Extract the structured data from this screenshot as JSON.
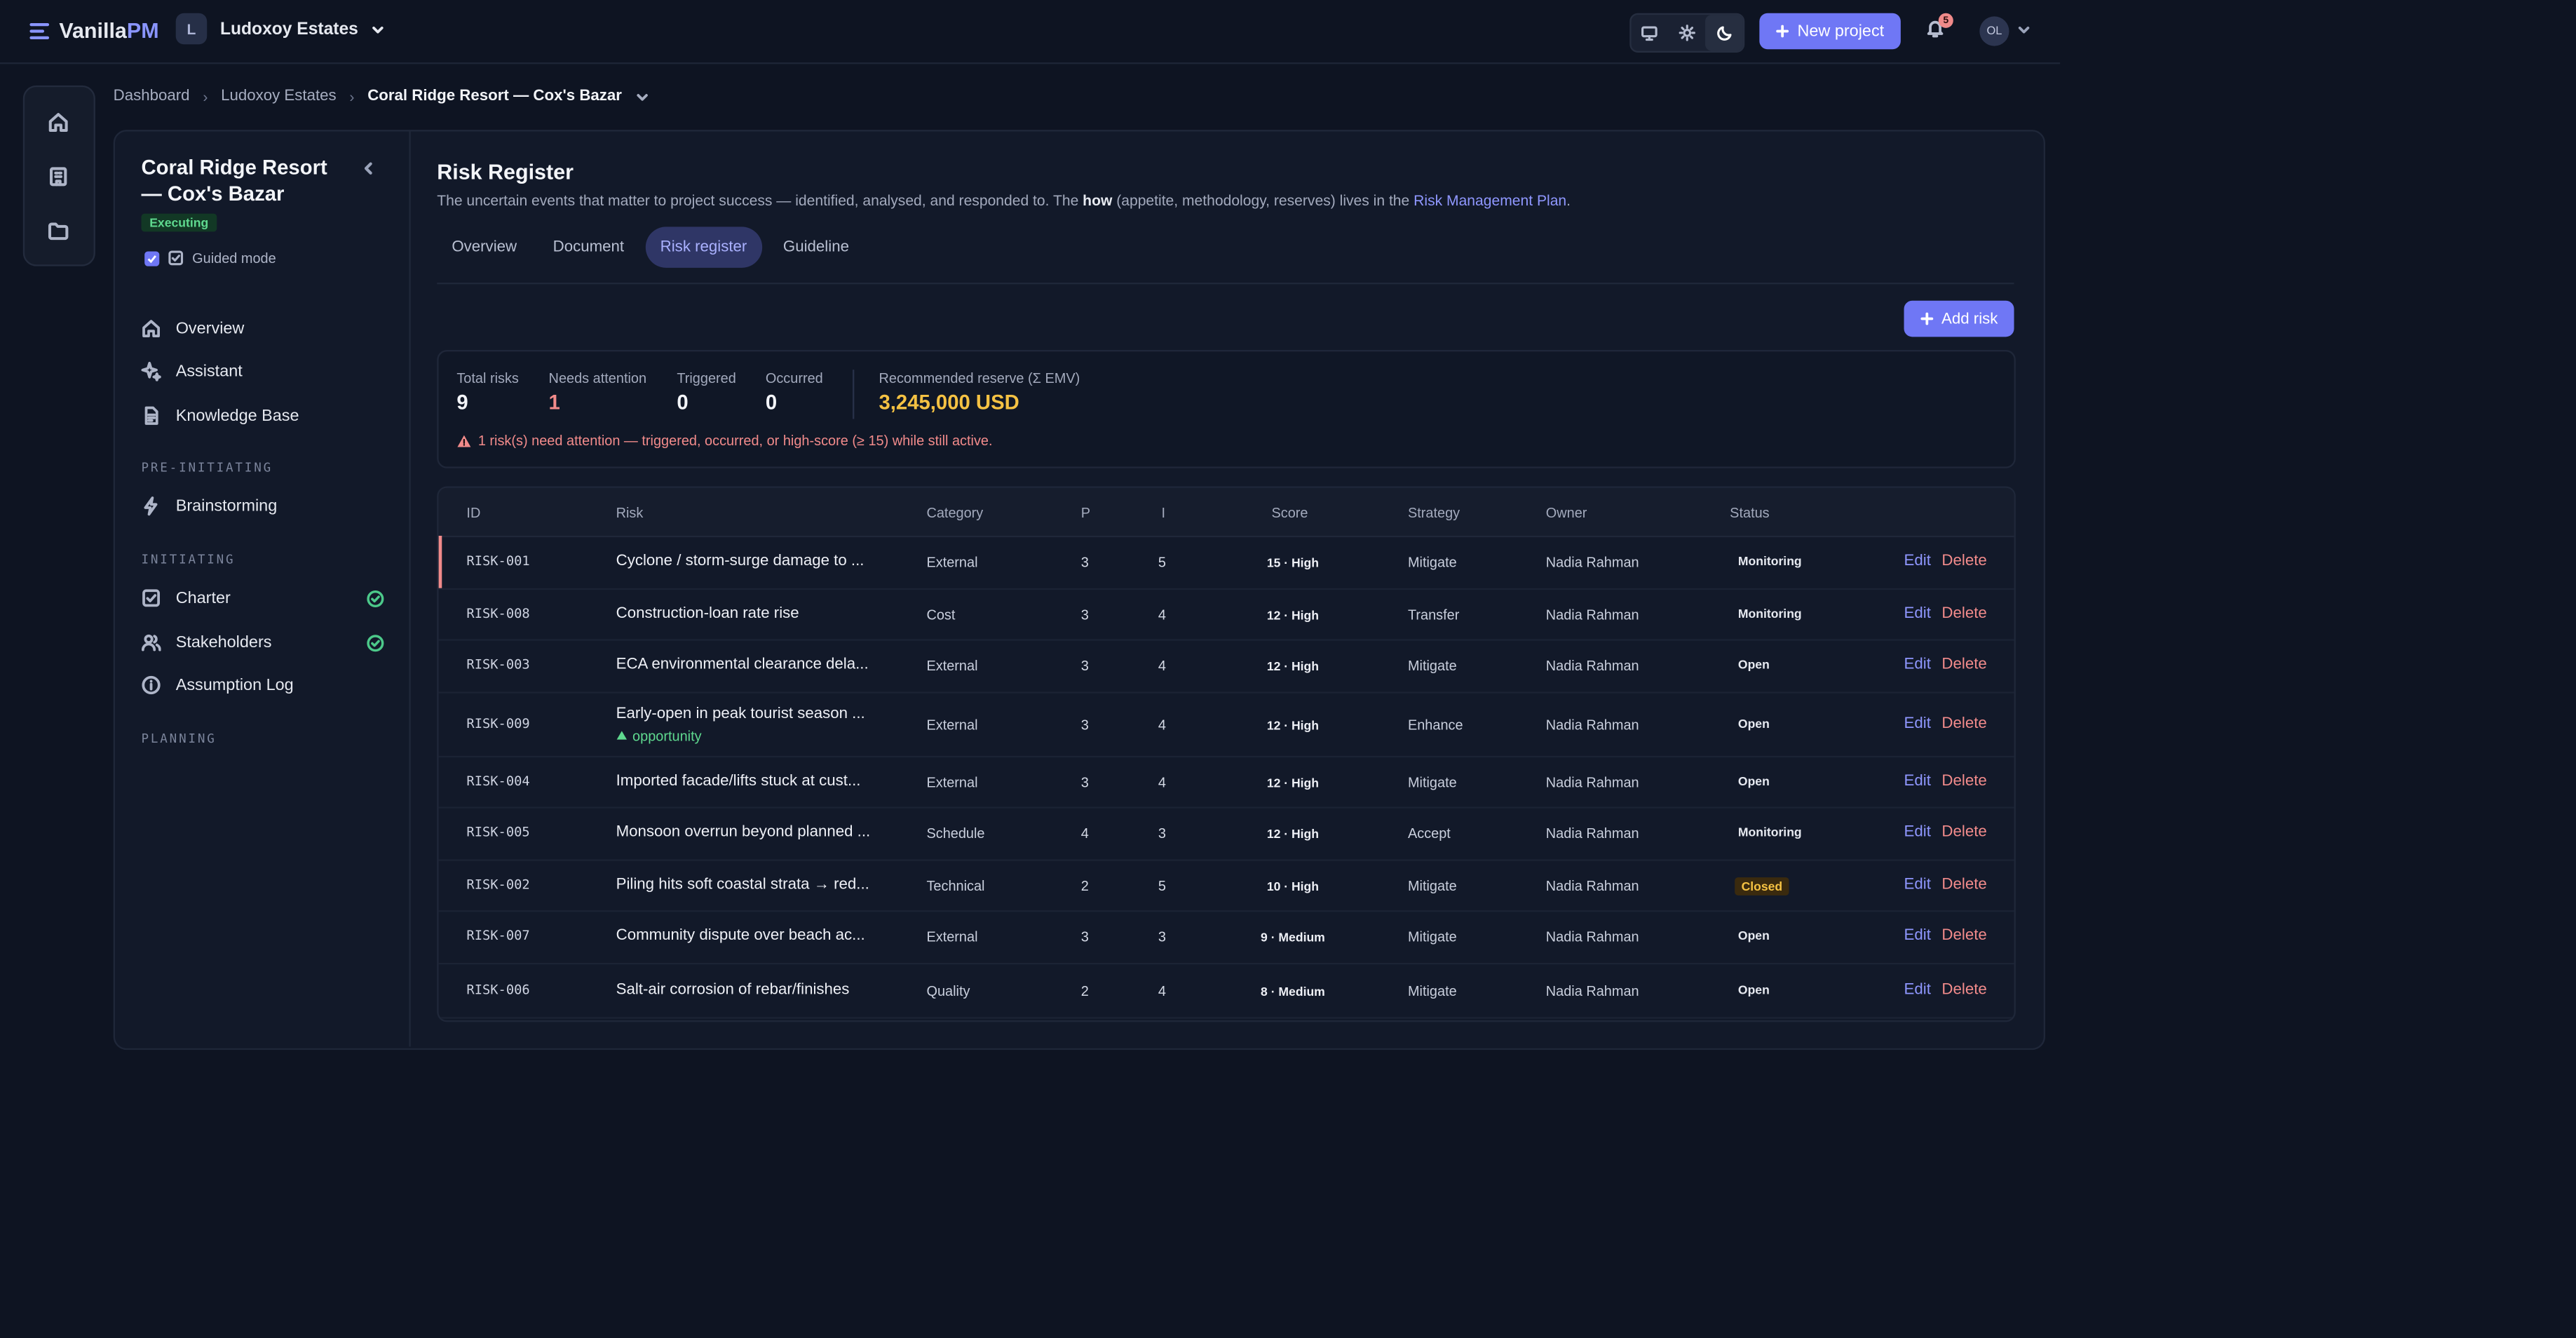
{
  "app": {
    "logo_a": "Vanilla",
    "logo_b": "PM"
  },
  "org": {
    "initial": "L",
    "name": "Ludoxoy Estates"
  },
  "topbar": {
    "new_project": "New project",
    "notifications": "5",
    "user_initials": "OL"
  },
  "breadcrumb": [
    "Dashboard",
    "Ludoxoy Estates",
    "Coral Ridge Resort — Cox's Bazar"
  ],
  "project": {
    "title": "Coral Ridge Resort — Cox's Bazar",
    "status": "Executing",
    "guided_mode": "Guided mode"
  },
  "nav": {
    "overview": "Overview",
    "assistant": "Assistant",
    "kb": "Knowledge Base",
    "sec_pre": "PRE-INITIATING",
    "brainstorming": "Brainstorming",
    "sec_init": "INITIATING",
    "charter": "Charter",
    "stakeholders": "Stakeholders",
    "assumption_log": "Assumption Log",
    "sec_plan": "PLANNING"
  },
  "page": {
    "title": "Risk Register",
    "desc_a": "The uncertain events that matter to project success — identified, analysed, and responded to. The ",
    "desc_b": "how",
    "desc_c": " (appetite, methodology, reserves) lives in the ",
    "desc_link": "Risk Management Plan",
    "desc_d": ".",
    "add_risk": "Add risk"
  },
  "tabs": [
    "Overview",
    "Document",
    "Risk register",
    "Guideline"
  ],
  "stats": {
    "total_label": "Total risks",
    "total": "9",
    "attention_label": "Needs attention",
    "attention": "1",
    "triggered_label": "Triggered",
    "triggered": "0",
    "occurred_label": "Occurred",
    "occurred": "0",
    "reserve_label": "Recommended reserve (Σ EMV)",
    "reserve": "3,245,000 USD",
    "alert": "1 risk(s) need attention — triggered, occurred, or high-score (≥ 15) while still active."
  },
  "table": {
    "headers": {
      "id": "ID",
      "risk": "Risk",
      "category": "Category",
      "p": "P",
      "i": "I",
      "score": "Score",
      "strategy": "Strategy",
      "owner": "Owner",
      "status": "Status"
    },
    "edit": "Edit",
    "delete": "Delete",
    "rows": [
      {
        "id": "RISK-001",
        "risk": "Cyclone / storm-surge damage to ...",
        "category": "External",
        "p": "3",
        "i": "5",
        "score": "15 · High",
        "strategy": "Mitigate",
        "owner": "Nadia Rahman",
        "status": "Monitoring",
        "tag": ""
      },
      {
        "id": "RISK-008",
        "risk": "Construction-loan rate rise",
        "category": "Cost",
        "p": "3",
        "i": "4",
        "score": "12 · High",
        "strategy": "Transfer",
        "owner": "Nadia Rahman",
        "status": "Monitoring",
        "tag": ""
      },
      {
        "id": "RISK-003",
        "risk": "ECA environmental clearance dela...",
        "category": "External",
        "p": "3",
        "i": "4",
        "score": "12 · High",
        "strategy": "Mitigate",
        "owner": "Nadia Rahman",
        "status": "Open",
        "tag": ""
      },
      {
        "id": "RISK-009",
        "risk": "Early-open in peak tourist season ...",
        "category": "External",
        "p": "3",
        "i": "4",
        "score": "12 · High",
        "strategy": "Enhance",
        "owner": "Nadia Rahman",
        "status": "Open",
        "tag": "opportunity"
      },
      {
        "id": "RISK-004",
        "risk": "Imported facade/lifts stuck at cust...",
        "category": "External",
        "p": "3",
        "i": "4",
        "score": "12 · High",
        "strategy": "Mitigate",
        "owner": "Nadia Rahman",
        "status": "Open",
        "tag": ""
      },
      {
        "id": "RISK-005",
        "risk": "Monsoon overrun beyond planned ...",
        "category": "Schedule",
        "p": "4",
        "i": "3",
        "score": "12 · High",
        "strategy": "Accept",
        "owner": "Nadia Rahman",
        "status": "Monitoring",
        "tag": ""
      },
      {
        "id": "RISK-002",
        "risk": "Piling hits soft coastal strata → red...",
        "category": "Technical",
        "p": "2",
        "i": "5",
        "score": "10 · High",
        "strategy": "Mitigate",
        "owner": "Nadia Rahman",
        "status": "Closed",
        "tag": ""
      },
      {
        "id": "RISK-007",
        "risk": "Community dispute over beach ac...",
        "category": "External",
        "p": "3",
        "i": "3",
        "score": "9 · Medium",
        "strategy": "Mitigate",
        "owner": "Nadia Rahman",
        "status": "Open",
        "tag": ""
      },
      {
        "id": "RISK-006",
        "risk": "Salt-air corrosion of rebar/finishes",
        "category": "Quality",
        "p": "2",
        "i": "4",
        "score": "8 · Medium",
        "strategy": "Mitigate",
        "owner": "Nadia Rahman",
        "status": "Open",
        "tag": ""
      }
    ]
  },
  "colors": {
    "accent": "#6f77f5",
    "danger": "#f28b8b",
    "success": "#5fd98f",
    "warning": "#f5c243",
    "bg": "#0e1422"
  },
  "icons": [
    "menu-icon",
    "chevron-down-icon",
    "monitor-icon",
    "sun-icon",
    "moon-icon",
    "plus-icon",
    "bell-icon",
    "home-icon",
    "building-icon",
    "folder-icon",
    "chevron-left-icon",
    "sparkle-icon",
    "document-icon",
    "bolt-icon",
    "checkbox-icon",
    "users-icon",
    "info-icon",
    "check-circle-icon",
    "warning-icon",
    "triangle-up-icon"
  ]
}
